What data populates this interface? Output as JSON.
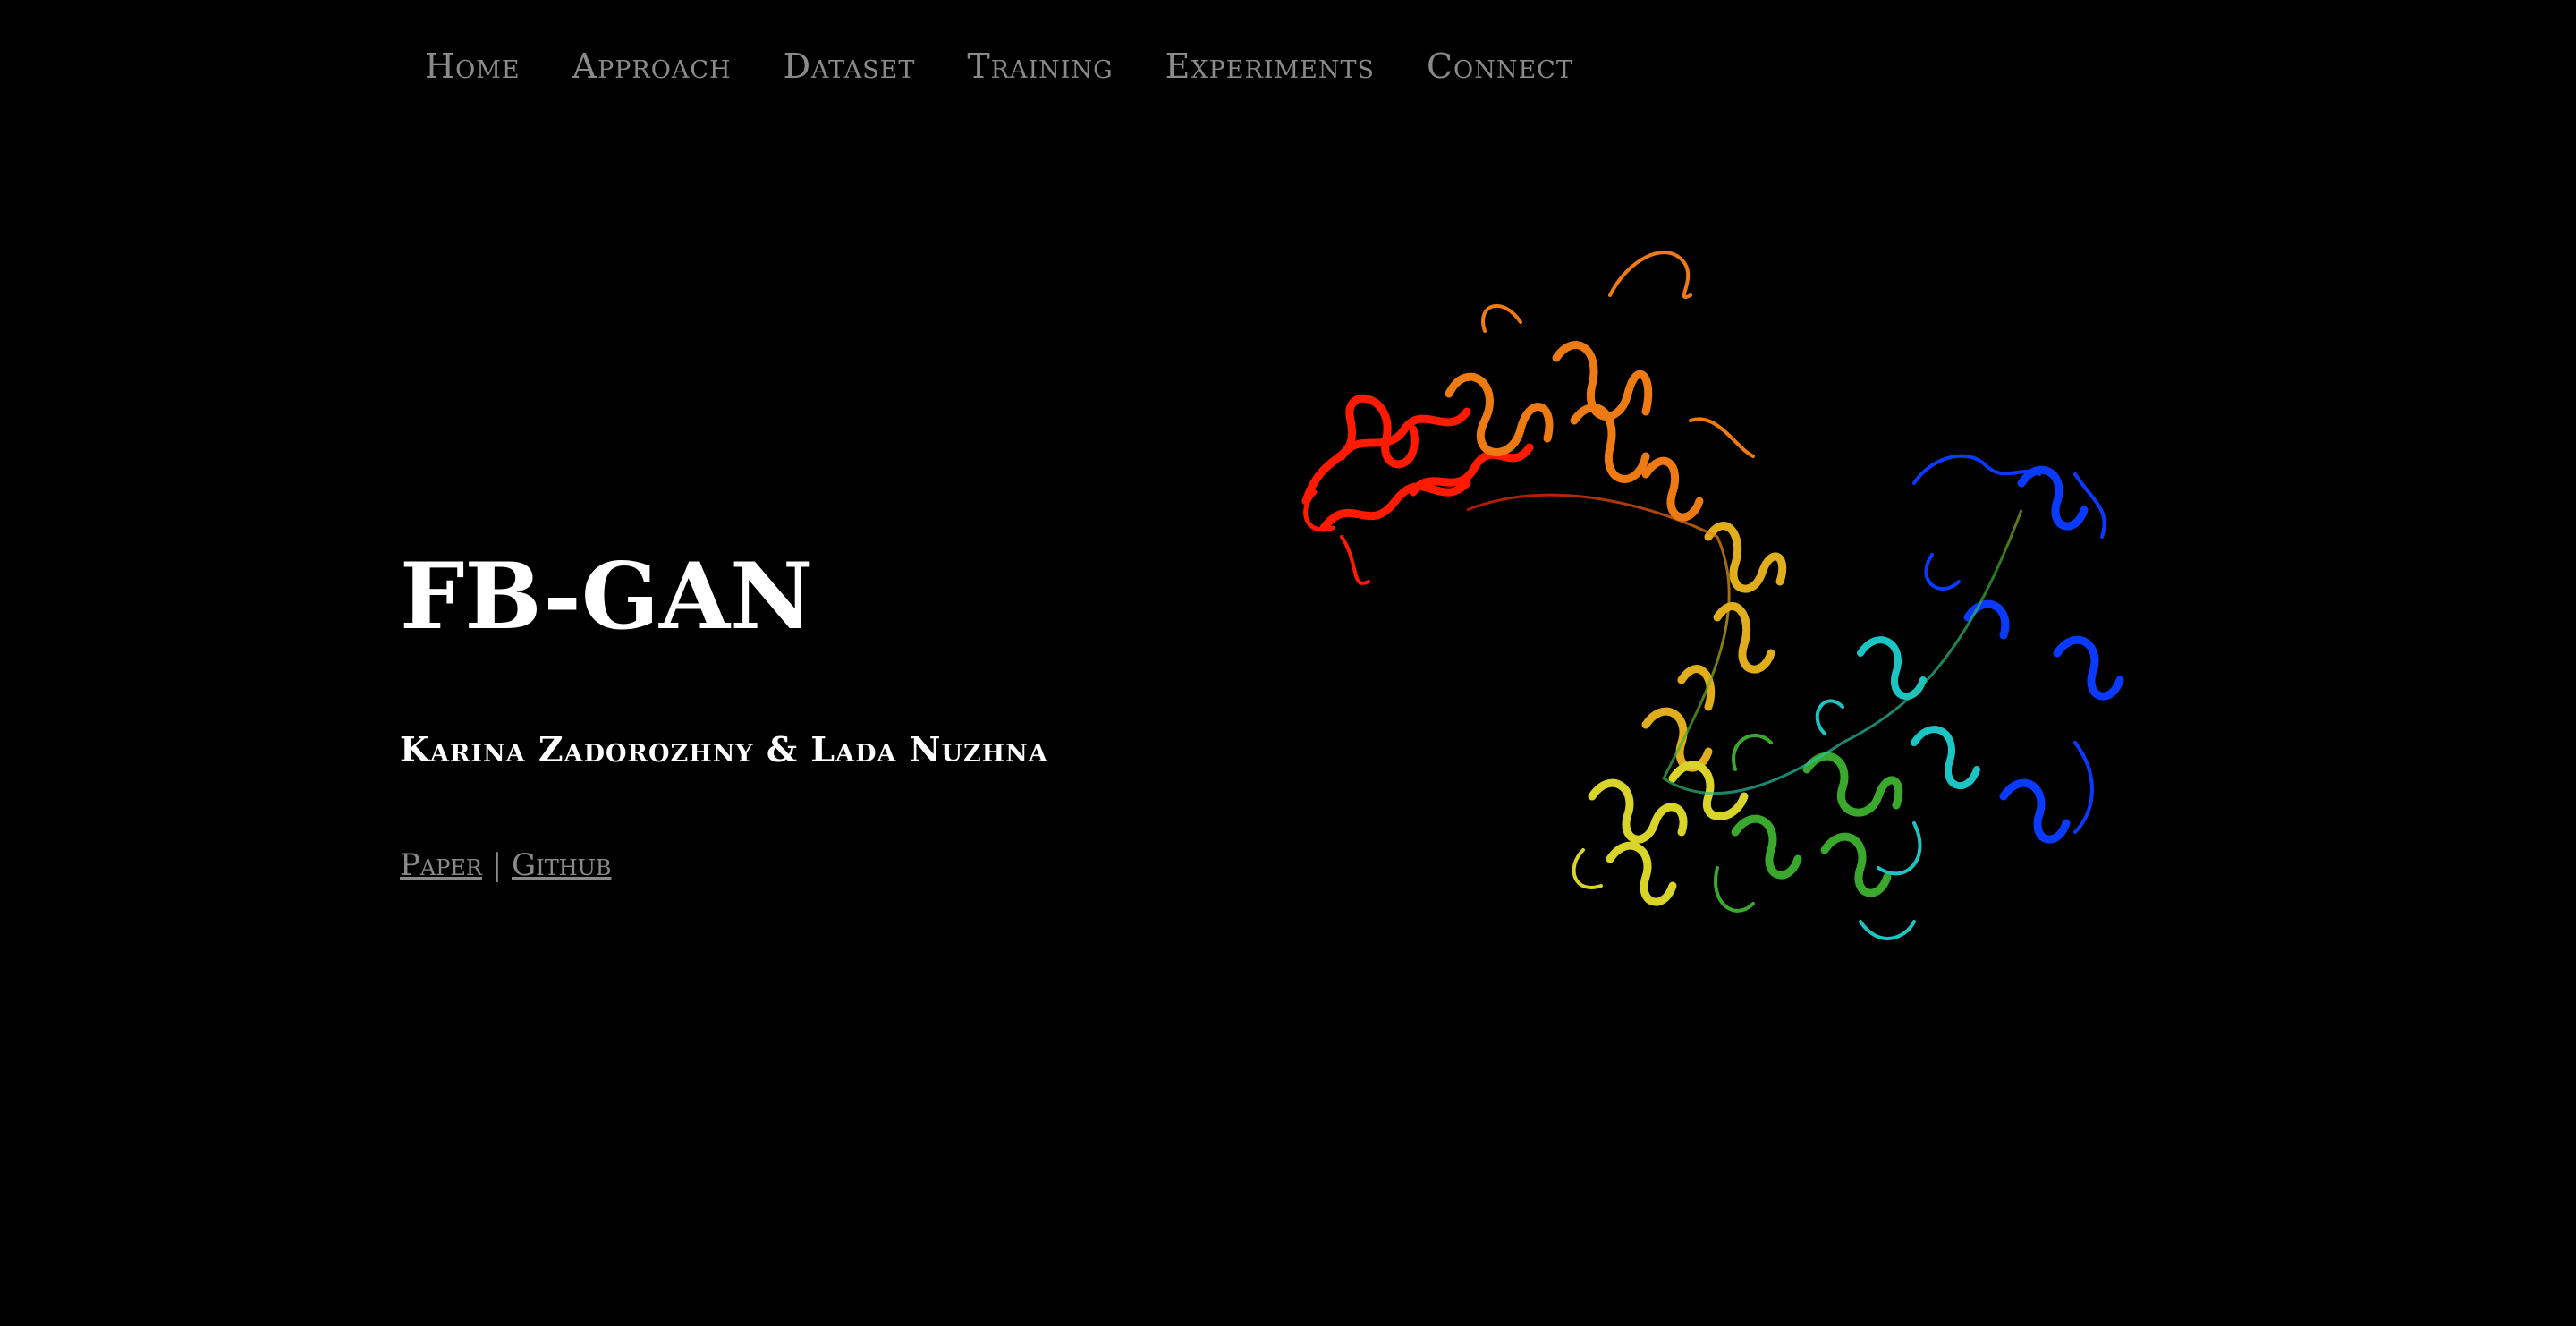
{
  "nav": {
    "items": [
      {
        "label": "Home"
      },
      {
        "label": "Approach"
      },
      {
        "label": "Dataset"
      },
      {
        "label": "Training"
      },
      {
        "label": "Experiments"
      },
      {
        "label": "Connect"
      }
    ]
  },
  "hero": {
    "title": "FB-GAN",
    "authors": "Karina Zadorozhny & Lada Nuzhna",
    "links": {
      "paper": "Paper",
      "separator": "|",
      "github": "Github"
    }
  },
  "colors": {
    "background": "#000000",
    "nav_text": "#8a8a8a",
    "title_text": "#ffffff",
    "protein_gradient": [
      "#ff1a00",
      "#f07a12",
      "#e3b21a",
      "#d8d42a",
      "#3fae2c",
      "#1dc7c7",
      "#0a3aff"
    ]
  },
  "image": {
    "icon": "protein-structure-image"
  }
}
